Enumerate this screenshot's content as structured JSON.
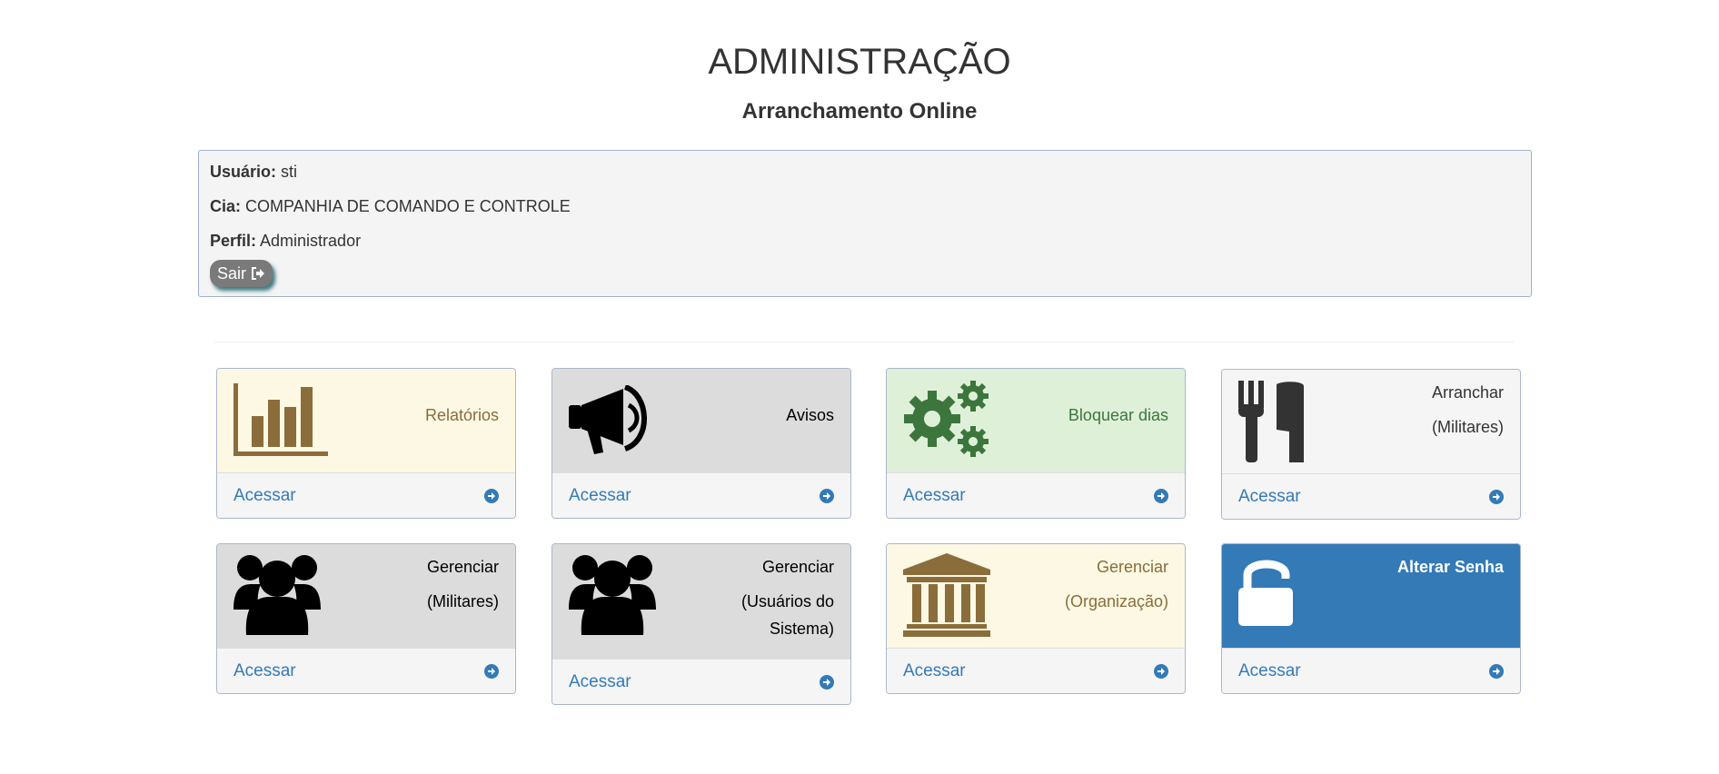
{
  "header": {
    "title": "ADMINISTRAÇÃO",
    "subtitle": "Arranchamento Online"
  },
  "user_info": {
    "user_label": "Usuário:",
    "user_value": "sti",
    "cia_label": "Cia:",
    "cia_value": "COMPANHIA DE COMANDO E CONTROLE",
    "profile_label": "Perfil:",
    "profile_value": "Administrador",
    "logout_label": "Sair"
  },
  "cards": [
    {
      "icon": "bar-chart-icon",
      "line1": "Relatórios",
      "line2": "",
      "line3": "",
      "link": "Acessar",
      "theme": "yellow"
    },
    {
      "icon": "megaphone-icon",
      "line1": "Avisos",
      "line2": "",
      "line3": "",
      "link": "Acessar",
      "theme": "grey"
    },
    {
      "icon": "gears-icon",
      "line1": "Bloquear dias",
      "line2": "",
      "line3": "",
      "link": "Acessar",
      "theme": "green"
    },
    {
      "icon": "cutlery-icon",
      "line1": "Arranchar",
      "line2": "(Militares)",
      "line3": "",
      "link": "Acessar",
      "theme": "light"
    },
    {
      "icon": "users-icon",
      "line1": "Gerenciar",
      "line2": "(Militares)",
      "line3": "",
      "link": "Acessar",
      "theme": "grey"
    },
    {
      "icon": "users-icon",
      "line1": "Gerenciar",
      "line2": "(Usuários do",
      "line3": "Sistema)",
      "link": "Acessar",
      "theme": "grey"
    },
    {
      "icon": "bank-icon",
      "line1": "Gerenciar",
      "line2": "(Organização)",
      "line3": "",
      "link": "Acessar",
      "theme": "yellow"
    },
    {
      "icon": "unlock-icon",
      "line1": "Alterar Senha",
      "line2": "",
      "line3": "",
      "link": "Acessar",
      "theme": "blue"
    }
  ],
  "colors": {
    "link": "#337ab7",
    "yellow_bg": "#fcf8e3",
    "yellow_text": "#8a6d3b",
    "grey_bg": "#dcdcdc",
    "green_bg": "#dff0d8",
    "green_text": "#3c763d",
    "blue_bg": "#337ab7"
  }
}
